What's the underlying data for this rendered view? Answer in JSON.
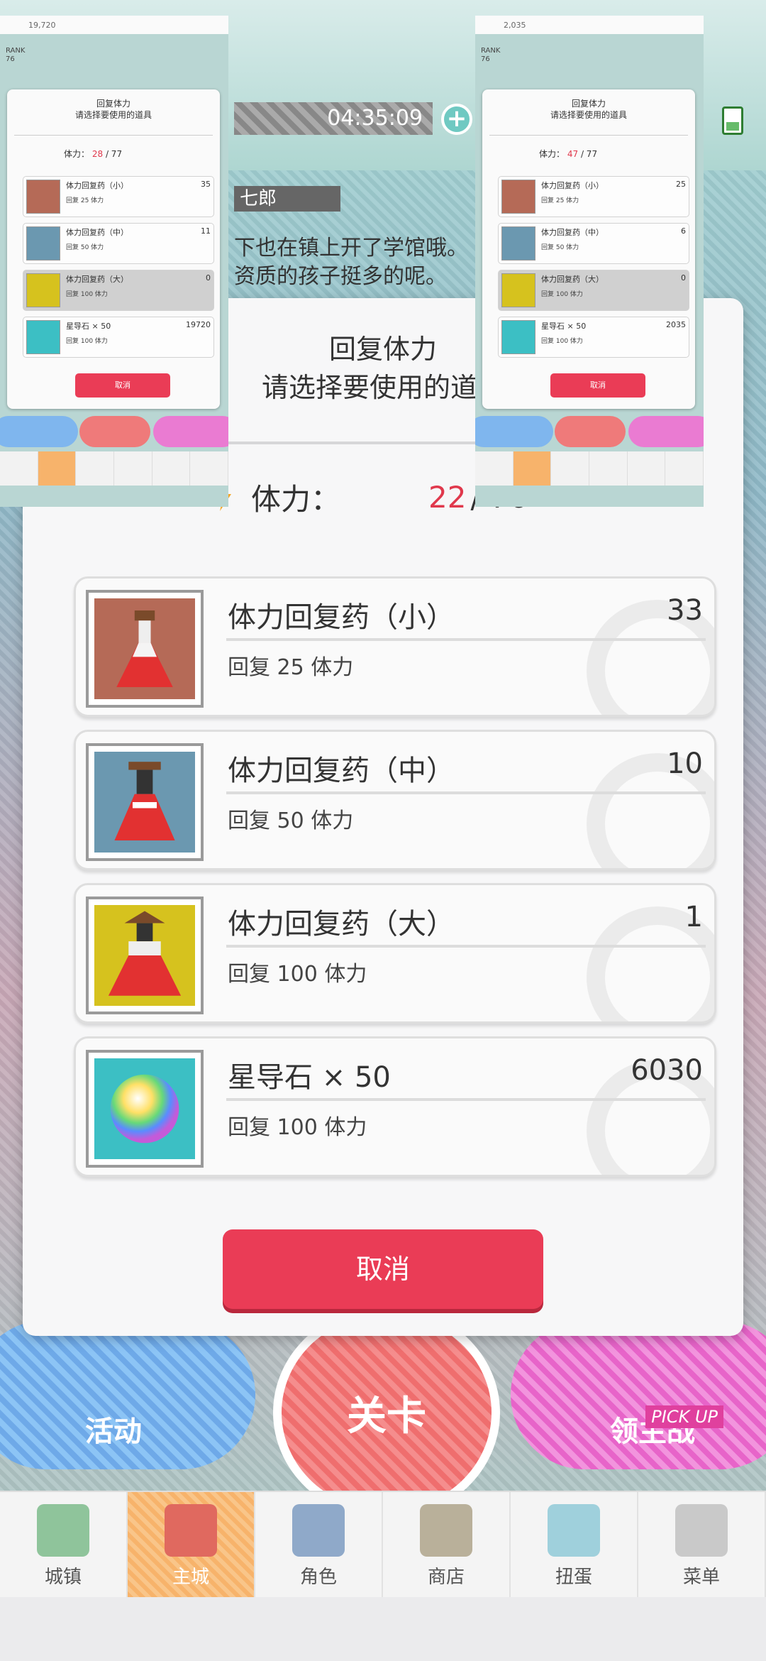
{
  "background": {
    "timer": "04:35:09",
    "speaker_tag": "七郎",
    "dialog_line1": "下也在镇上开了学馆哦。",
    "dialog_line2": "资质的孩子挺多的呢。"
  },
  "dialog": {
    "title": "回复体力",
    "subtitle": "请选择要使用的道具",
    "stamina_label": "体力：",
    "stamina_current": "22",
    "stamina_sep": "/ 76",
    "items": [
      {
        "name": "体力回复药（小）",
        "count": "33",
        "desc": "回复 25 体力",
        "icon": "potion-small-icon",
        "bg": "#b56a57"
      },
      {
        "name": "体力回复药（中）",
        "count": "10",
        "desc": "回复 50 体力",
        "icon": "potion-medium-icon",
        "bg": "#6b98b0"
      },
      {
        "name": "体力回复药（大）",
        "count": "1",
        "desc": "回复 100 体力",
        "icon": "potion-large-icon",
        "bg": "#d6c21e"
      },
      {
        "name": "星导石 × 50",
        "count": "6030",
        "desc": "回复 100 体力",
        "icon": "rainbow-orb-icon",
        "bg": "#3cbfc4"
      }
    ],
    "cancel_label": "取消"
  },
  "bottom": {
    "event_label": "活动",
    "stage_label": "关卡",
    "pickup_label": "领主战",
    "pickup_tag": "PICK UP",
    "nav": [
      {
        "label": "城镇",
        "icon": "town-icon"
      },
      {
        "label": "主城",
        "icon": "castle-icon"
      },
      {
        "label": "角色",
        "icon": "character-icon"
      },
      {
        "label": "商店",
        "icon": "shop-icon"
      },
      {
        "label": "扭蛋",
        "icon": "gacha-icon"
      },
      {
        "label": "菜单",
        "icon": "menu-icon"
      }
    ]
  },
  "mini_left": {
    "status_currency": "19,720",
    "rank_label": "RANK",
    "rank_value": "76",
    "title": "回复体力",
    "subtitle": "请选择要使用的道具",
    "stamina_label": "体力：",
    "stamina_current": "28",
    "stamina_sep": "/ 77",
    "items": [
      {
        "name": "体力回复药（小）",
        "count": "35",
        "desc": "回复 25 体力"
      },
      {
        "name": "体力回复药（中）",
        "count": "11",
        "desc": "回复 50 体力"
      },
      {
        "name": "体力回复药（大）",
        "count": "0",
        "desc": "回复 100 体力"
      },
      {
        "name": "星导石 × 50",
        "count": "19720",
        "desc": "回复 100 体力"
      }
    ],
    "cancel_label": "取消"
  },
  "mini_right": {
    "status_currency": "2,035",
    "rank_label": "RANK",
    "rank_value": "76",
    "title": "回复体力",
    "subtitle": "请选择要使用的道具",
    "stamina_label": "体力：",
    "stamina_current": "47",
    "stamina_sep": "/ 77",
    "items": [
      {
        "name": "体力回复药（小）",
        "count": "25",
        "desc": "回复 25 体力"
      },
      {
        "name": "体力回复药（中）",
        "count": "6",
        "desc": "回复 50 体力"
      },
      {
        "name": "体力回复药（大）",
        "count": "0",
        "desc": "回复 100 体力"
      },
      {
        "name": "星导石 × 50",
        "count": "2035",
        "desc": "回复 100 体力"
      }
    ],
    "cancel_label": "取消"
  },
  "colors": {
    "accent_red": "#ea3c56",
    "stamina_red": "#e0384c",
    "nav_active": "#f7b36b"
  }
}
